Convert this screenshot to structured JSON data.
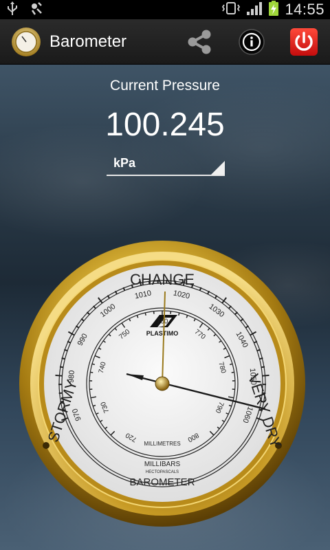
{
  "status_bar": {
    "time": "14:55",
    "icons": [
      "usb-icon",
      "debug-icon",
      "vibrate-icon",
      "signal-icon",
      "battery-charging-icon"
    ]
  },
  "action_bar": {
    "app_icon": "barometer-app-icon",
    "title": "Barometer",
    "actions": [
      {
        "name": "share-button",
        "icon": "share-icon"
      },
      {
        "name": "info-button",
        "icon": "info-icon"
      },
      {
        "name": "power-button",
        "icon": "power-icon"
      }
    ]
  },
  "main": {
    "label": "Current Pressure",
    "value": "100.245",
    "unit": "kPa"
  },
  "gauge": {
    "words": {
      "top": "CHANGE",
      "left": "STORMY",
      "right": "VERY DRY",
      "bottom": "BAROMETER"
    },
    "brand": "PLASTIMO",
    "inner_label": "MILLIMETRES",
    "outer_label": "MILLIBARS",
    "outer_sub": "HECTOPASCALS",
    "mb_ticks": [
      "970",
      "980",
      "990",
      "1000",
      "1010",
      "1020",
      "1030",
      "1040",
      "1050",
      "1060"
    ],
    "mm_ticks": [
      "720",
      "730",
      "740",
      "750",
      "760",
      "770",
      "780",
      "790",
      "800"
    ],
    "colors": {
      "brass": "#c9a227",
      "dial": "#f2f2f2",
      "needle": "#222222"
    }
  }
}
